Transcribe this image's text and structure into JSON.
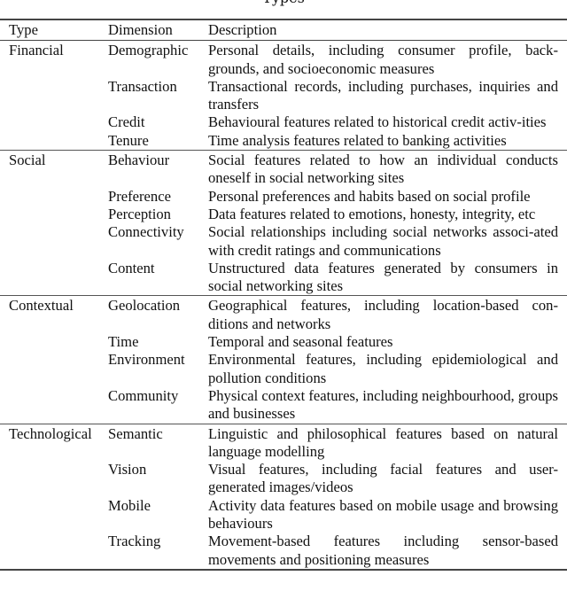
{
  "caption": "Types",
  "table": {
    "headers": {
      "type": "Type",
      "dimension": "Dimension",
      "description": "Description"
    },
    "groups": [
      {
        "type": "Financial",
        "rows": [
          {
            "dimension": "Demographic",
            "description": "Personal details, including consumer profile, back-grounds, and socioeconomic measures"
          },
          {
            "dimension": "Transaction",
            "description": "Transactional records, including purchases, inquiries and transfers"
          },
          {
            "dimension": "Credit",
            "description": "Behavioural features related to historical credit activ-ities"
          },
          {
            "dimension": "Tenure",
            "description": "Time analysis features related to banking activities"
          }
        ]
      },
      {
        "type": "Social",
        "rows": [
          {
            "dimension": "Behaviour",
            "description": "Social features related to how an individual conducts oneself in social networking sites"
          },
          {
            "dimension": "Preference",
            "description": "Personal preferences and habits based on social profile"
          },
          {
            "dimension": "Perception",
            "description": "Data features related to emotions, honesty, integrity, etc"
          },
          {
            "dimension": "Connectivity",
            "description": "Social relationships including social networks associ-ated with credit ratings and communications"
          },
          {
            "dimension": "Content",
            "description": "Unstructured data features generated by consumers in social networking sites"
          }
        ]
      },
      {
        "type": "Contextual",
        "rows": [
          {
            "dimension": "Geolocation",
            "description": "Geographical features, including location-based con-ditions and networks"
          },
          {
            "dimension": "Time",
            "description": "Temporal and seasonal features"
          },
          {
            "dimension": "Environment",
            "description": "Environmental features, including epidemiological and pollution conditions"
          },
          {
            "dimension": "Community",
            "description": "Physical context features, including neighbourhood, groups and businesses"
          }
        ]
      },
      {
        "type": "Technological",
        "rows": [
          {
            "dimension": "Semantic",
            "description": "Linguistic and philosophical features based on natural language modelling"
          },
          {
            "dimension": "Vision",
            "description": "Visual features, including facial features and user-generated images/videos"
          },
          {
            "dimension": "Mobile",
            "description": "Activity data features based on mobile usage and browsing behaviours"
          },
          {
            "dimension": "Tracking",
            "description": "Movement-based features including sensor-based movements and positioning measures"
          }
        ]
      }
    ]
  }
}
